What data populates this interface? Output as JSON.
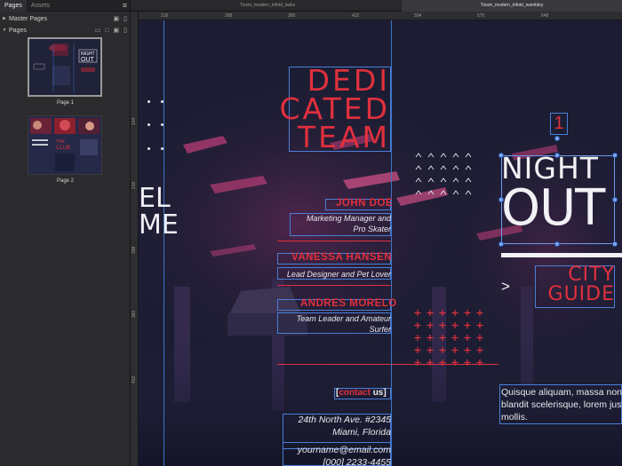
{
  "panel": {
    "tabs": [
      "Pages",
      "Assets"
    ],
    "menu_icon": "hamburger-menu-icon",
    "master_pages_label": "Master Pages",
    "pages_label": "Pages",
    "page_labels": [
      "Page 1",
      "Page 2"
    ]
  },
  "document_tabs": [
    "Tiosm_modern_trifold_tasks",
    "Tiosm_modern_trifold_wambley"
  ],
  "ruler": {
    "top": [
      "216",
      "288",
      "360",
      "432",
      "504",
      "576",
      "648"
    ],
    "left": [
      "144",
      "216",
      "288",
      "360",
      "432"
    ]
  },
  "canvas": {
    "left_partial": [
      "EL",
      "ME"
    ],
    "team_heading": [
      "DEDI",
      "CATED",
      "TEAM"
    ],
    "members": [
      {
        "name": "JOHN DOE",
        "role": [
          "Marketing Manager and",
          "Pro Skater"
        ]
      },
      {
        "name": "VANESSA HANSEN",
        "role": [
          "Lead Designer and Pet Lover"
        ]
      },
      {
        "name": "ANDRES MORELO",
        "role": [
          "Team Leader and Amateur",
          "Surfer"
        ]
      }
    ],
    "contact_label": "[contact us]",
    "contact_word_red": "contact",
    "contact_word_white": "us",
    "address": [
      "24th North Ave. #2345",
      "Miami, Florida"
    ],
    "email": "yourname@email.com",
    "phone": "[000] 2233-4455",
    "page_number": "1",
    "night": "NIGHT",
    "out": "OUT",
    "city_guide": [
      "CITY",
      "GUIDE"
    ],
    "arrow": ">",
    "body_text": [
      "Quisque aliquam, massa non",
      "blandit scelerisque, lorem justo",
      "mollis."
    ],
    "accent_red": "#e0303d",
    "background": "#1c1d33",
    "guide_blue": "#3c74c9"
  }
}
